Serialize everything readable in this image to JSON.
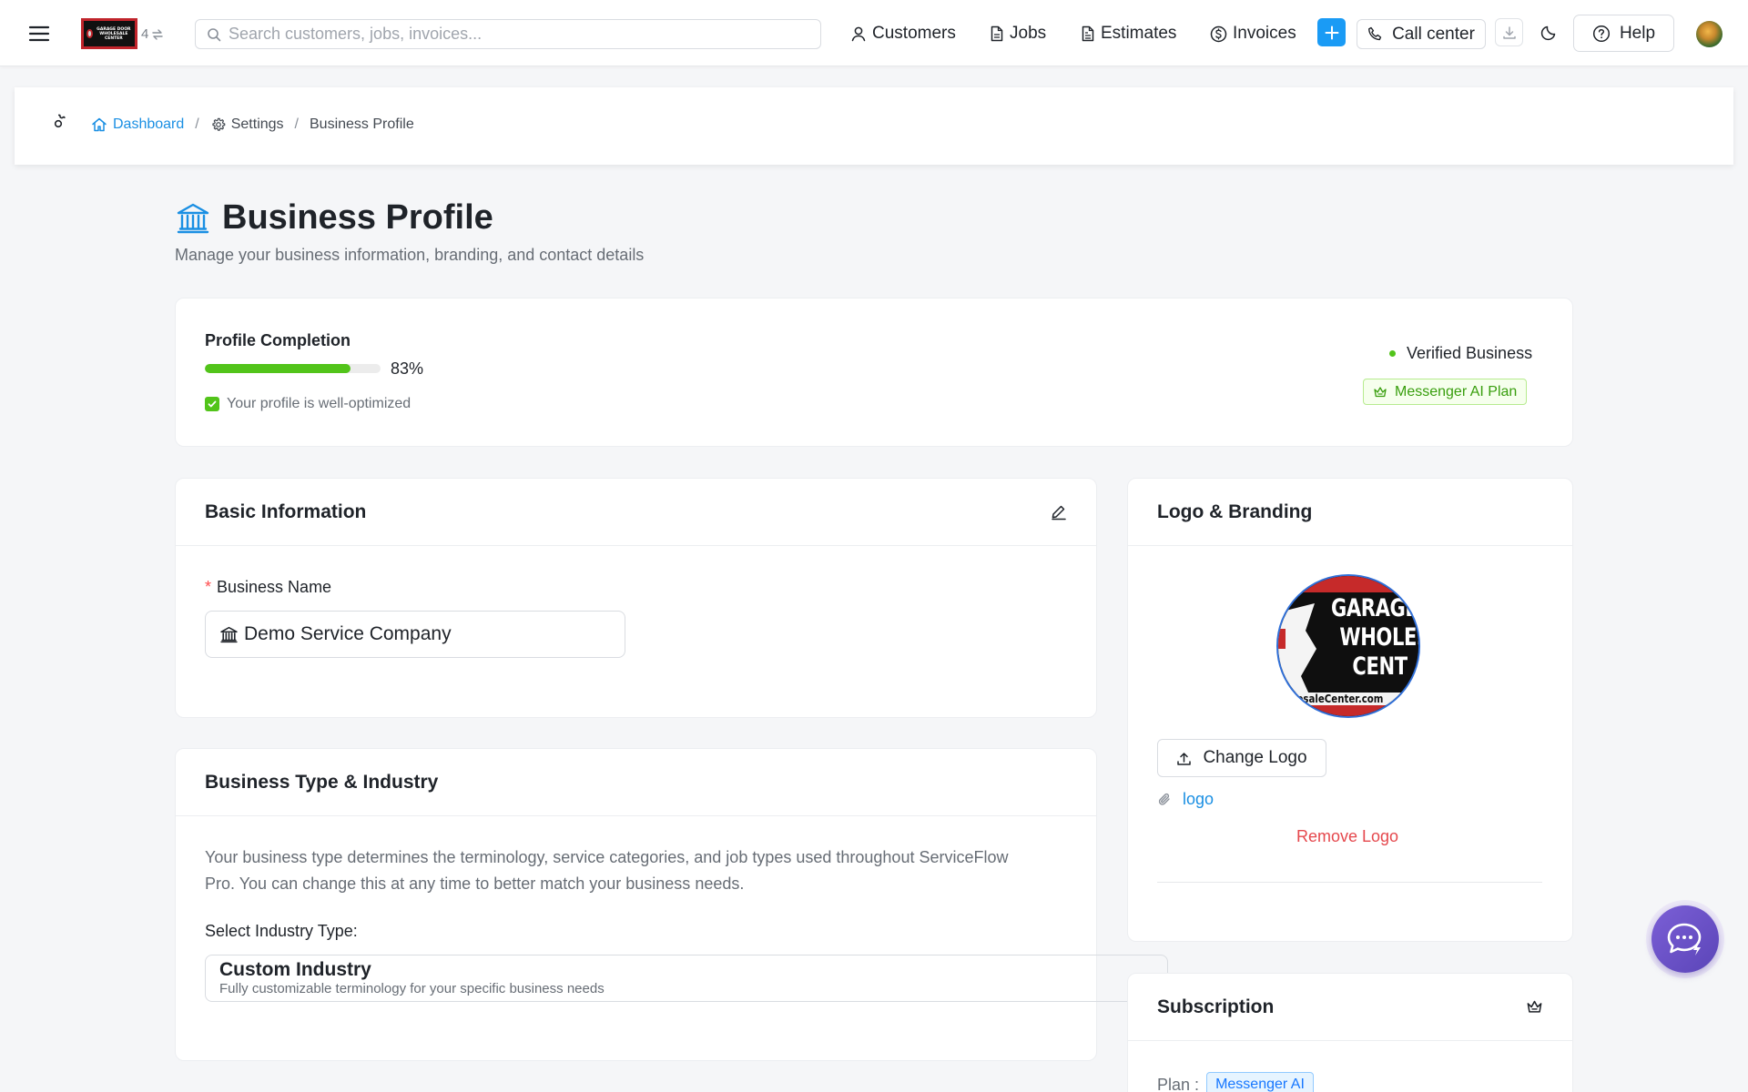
{
  "topbar": {
    "logo_text": "GARAGE DOOR WHOLESALE CENTER",
    "badge_count": "4",
    "search_placeholder": "Search customers, jobs, invoices...",
    "nav": {
      "customers": "Customers",
      "jobs": "Jobs",
      "estimates": "Estimates",
      "invoices": "Invoices",
      "call_center": "Call center",
      "help": "Help"
    },
    "accent_color": "#1a9bf5"
  },
  "breadcrumb": {
    "dashboard": "Dashboard",
    "settings": "Settings",
    "current": "Business Profile",
    "separator": "/"
  },
  "page": {
    "title": "Business Profile",
    "subtitle": "Manage your business information, branding, and contact details"
  },
  "completion": {
    "label": "Profile Completion",
    "percent_value": 83,
    "percent_text": "83%",
    "status": "Your profile is well-optimized",
    "verified": "Verified Business",
    "plan_tag": "Messenger AI Plan",
    "bar_color": "#52c41a"
  },
  "basic_info": {
    "title": "Basic Information",
    "business_name_label": "Business Name",
    "required_mark": "*",
    "business_name_value": "Demo Service Company"
  },
  "business_type": {
    "title": "Business Type & Industry",
    "description": "Your business type determines the terminology, service categories, and job types used throughout ServiceFlow Pro. You can change this at any time to better match your business needs.",
    "select_label": "Select Industry Type:",
    "selected_title": "Custom Industry",
    "selected_subtitle": "Fully customizable terminology for your specific business needs"
  },
  "branding": {
    "title": "Logo & Branding",
    "logo_lines": [
      "GARAGE",
      "WHOLES",
      "CENT"
    ],
    "logo_url_text": "olesaleCenter.com",
    "change_logo": "Change Logo",
    "file_name": "logo",
    "remove_logo": "Remove Logo"
  },
  "subscription": {
    "title": "Subscription",
    "plan_label": "Plan",
    "plan_colon": ":",
    "plan_value": "Messenger AI"
  },
  "icons": [
    "menu-icon",
    "swap-icon",
    "search-icon",
    "user-icon",
    "file-icon",
    "estimate-icon",
    "dollar-icon",
    "plus-icon",
    "phone-icon",
    "download-icon",
    "moon-icon",
    "help-icon",
    "settings-icon",
    "home-icon",
    "bank-icon",
    "check-icon",
    "crown-icon",
    "edit-icon",
    "upload-icon",
    "paperclip-icon",
    "chevron-down-icon",
    "chat-icon"
  ]
}
